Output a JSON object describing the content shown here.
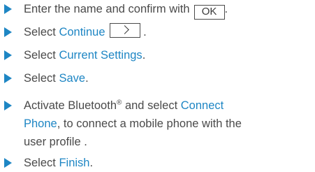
{
  "steps": [
    {
      "before": "Enter the name and confirm with",
      "key": "OK",
      "after": "."
    },
    {
      "before": "Select ",
      "link": "Continue",
      "after": "."
    },
    {
      "before": "Select ",
      "link": "Current Settings",
      "after": "."
    },
    {
      "before": "Select ",
      "link": "Save",
      "after": "."
    },
    {
      "line1_before": "Activate Bluetooth",
      "trademark": "®",
      "line1_after": " and select ",
      "link_line1": "Connect",
      "link_line2": "Phone",
      "line2_after": ", to connect a mobile phone with the",
      "line3": "user profile ."
    },
    {
      "before": "Select ",
      "link": "Finish",
      "after": "."
    }
  ],
  "icons": {
    "bullet": "triangle-right-icon",
    "continue_key": "chevron-right-icon"
  },
  "colors": {
    "accent": "#1e86c4",
    "text": "#4a4a4a"
  }
}
